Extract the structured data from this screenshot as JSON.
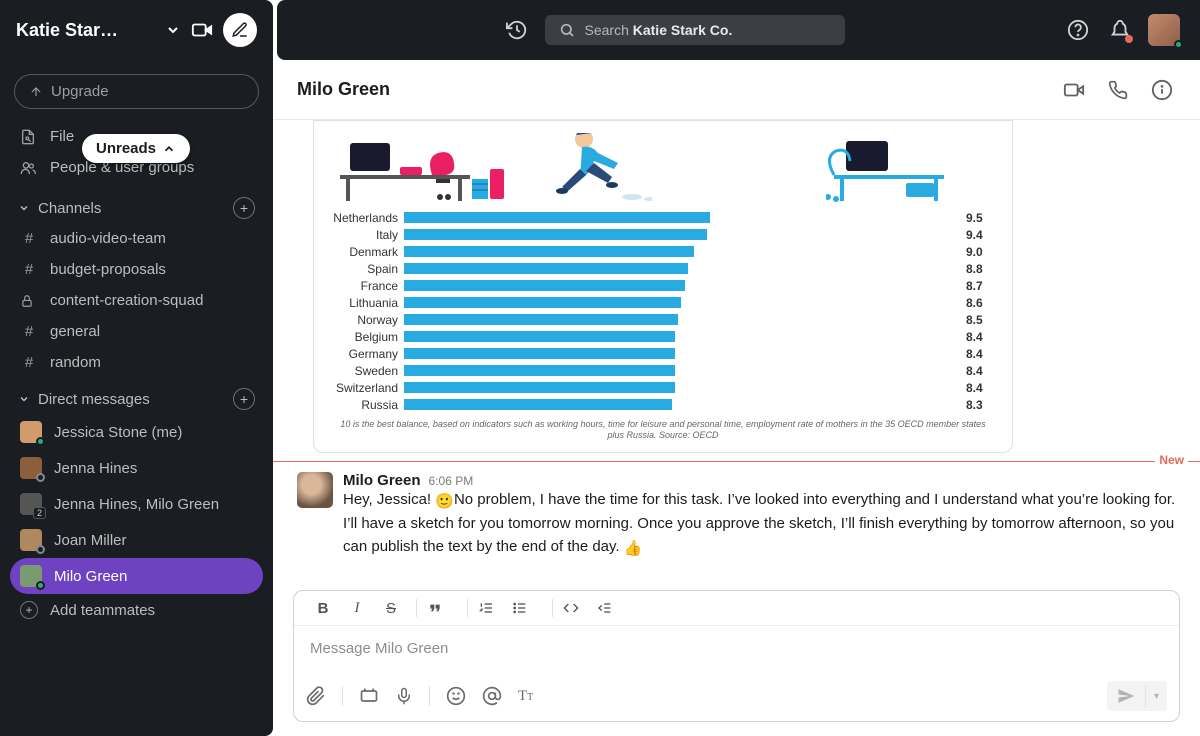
{
  "workspace": {
    "name": "Katie Star…"
  },
  "upgrade": "Upgrade",
  "unreads_pill": "Unreads",
  "nav": {
    "file": "File",
    "people": "People & user groups"
  },
  "channels": {
    "heading": "Channels",
    "items": [
      {
        "name": "audio-video-team",
        "type": "hash"
      },
      {
        "name": "budget-proposals",
        "type": "hash"
      },
      {
        "name": "content-creation-squad",
        "type": "lock"
      },
      {
        "name": "general",
        "type": "hash"
      },
      {
        "name": "random",
        "type": "hash"
      }
    ]
  },
  "dms": {
    "heading": "Direct messages",
    "items": [
      {
        "name": "Jessica Stone (me)",
        "presence": "online"
      },
      {
        "name": "Jenna Hines",
        "presence": "offline"
      },
      {
        "name": "Jenna Hines, Milo Green",
        "presence": "group"
      },
      {
        "name": "Joan Miller",
        "presence": "offline"
      },
      {
        "name": "Milo Green",
        "presence": "online",
        "active": true
      }
    ],
    "add": "Add teammates"
  },
  "search": {
    "prefix": "Search",
    "scope": "Katie Stark Co."
  },
  "conversation": {
    "title": "Milo Green",
    "new_divider": "New",
    "message": {
      "author": "Milo Green",
      "time": "6:06 PM",
      "text_before": "Hey, Jessica! ",
      "text_after": "No problem, I have the time for this task. I’ve looked into everything and I understand what you’re looking for. I’ll have a sketch for you tomorrow morning. Once you approve the sketch, I’ll finish everything by tomorrow afternoon, so you can publish the text by the end of the day. "
    }
  },
  "composer": {
    "placeholder": "Message Milo Green"
  },
  "chart_data": {
    "type": "bar",
    "orientation": "horizontal",
    "categories": [
      "Netherlands",
      "Italy",
      "Denmark",
      "Spain",
      "France",
      "Lithuania",
      "Norway",
      "Belgium",
      "Germany",
      "Sweden",
      "Switzerland",
      "Russia"
    ],
    "values": [
      9.5,
      9.4,
      9.0,
      8.8,
      8.7,
      8.6,
      8.5,
      8.4,
      8.4,
      8.4,
      8.4,
      8.3
    ],
    "xlim": [
      0,
      10
    ],
    "footnote": "10 is the best balance, based on indicators such as working hours, time for leisure and personal time, employment rate of mothers in the 35 OECD member states plus Russia. Source: OECD"
  }
}
